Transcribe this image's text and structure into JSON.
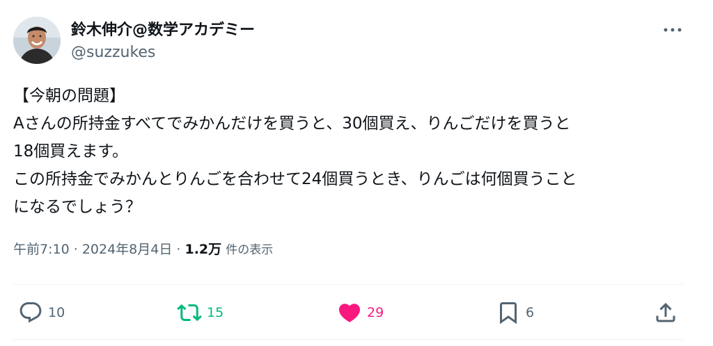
{
  "author": {
    "display_name": "鈴木伸介@数学アカデミー",
    "handle": "@suzzukes",
    "avatar_icon": "user-avatar-photo"
  },
  "tweet": {
    "lines": [
      "【今朝の問題】",
      "Aさんの所持金すべてでみかんだけを買うと、30個買え、りんごだけを買うと",
      "18個買えます。",
      "この所持金でみかんとりんごを合わせて24個買うとき、りんごは何個買うこと",
      "になるでしょう？"
    ]
  },
  "meta": {
    "time": "午前7:10",
    "separator": "·",
    "date": "2024年8月4日",
    "views_count": "1.2万",
    "views_label": "件の表示"
  },
  "actions": {
    "reply_count": "10",
    "retweet_count": "15",
    "like_count": "29",
    "bookmark_count": "6"
  },
  "colors": {
    "retweet": "#00ba7c",
    "like": "#f91880",
    "secondary_text": "#536471"
  }
}
